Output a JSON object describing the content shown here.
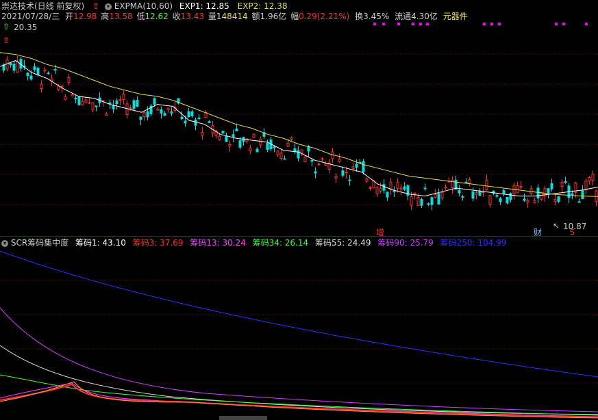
{
  "header": {
    "stock_title": "崇达技术(日线 前复权)",
    "indicator_name": "EXPMA(10,60)",
    "exp1_label": "EXP1: 12.85",
    "exp2_label": "EXP2: 12.38"
  },
  "quote": {
    "date": "2021/07/28/三",
    "open_label": "开",
    "open": "12.98",
    "high_label": "高",
    "high": "13.58",
    "low_label": "低",
    "low": "12.62",
    "close_label": "收",
    "close": "13.43",
    "volume_label": "量",
    "volume": "148414",
    "amount_label": "额",
    "amount": "1.96亿",
    "change_label": "幅",
    "change": "0.29(2.21%)",
    "turnover_label": "换",
    "turnover": "3.45%",
    "float_label": "流通",
    "float": "4.30亿",
    "sector": "元器件"
  },
  "price_chart": {
    "high_marker": "20.35",
    "low_marker": "10.87",
    "event_labels": [
      "增",
      "财",
      "S"
    ],
    "colors": {
      "up": "#ff3030",
      "down": "#00e0e0",
      "exp1": "#ffffff",
      "exp2": "#e8e04a",
      "grid": "#8b0000"
    }
  },
  "indicator": {
    "name": "SCR筹码集中度",
    "c1": "筹码1: 43.10",
    "c3": "筹码3: 37.69",
    "c13": "筹码13: 30.24",
    "c34": "筹码34: 26.14",
    "c55": "筹码55: 24.49",
    "c90": "筹码90: 25.79",
    "c250": "筹码250: 104.99",
    "colors": {
      "c1": "#ffffff",
      "c3": "#ff3030",
      "c13": "#ff40ff",
      "c34": "#40ff40",
      "c55": "#dddddd",
      "c90": "#cc40ff",
      "c250": "#3030ff"
    }
  },
  "chart_data": {
    "type": "line",
    "title": "崇达技术(日线 前复权)",
    "series": [
      {
        "name": "EXP1",
        "values": [
          18.9,
          19.2,
          18.6,
          18.3,
          17.8,
          17.4,
          17.3,
          17.0,
          16.8,
          16.6,
          17.0,
          16.9,
          16.2,
          16.0,
          15.5,
          15.3,
          15.2,
          15.1,
          14.7,
          14.6,
          14.2,
          14.0,
          13.8,
          13.6,
          13.0,
          12.7,
          12.5,
          12.4,
          12.6,
          12.8,
          12.7,
          12.6,
          12.5,
          12.4,
          12.4,
          12.5,
          12.6,
          12.7,
          12.85
        ]
      },
      {
        "name": "EXP2",
        "values": [
          19.6,
          19.5,
          19.3,
          19.0,
          18.8,
          18.5,
          18.2,
          17.9,
          17.7,
          17.5,
          17.4,
          17.2,
          16.9,
          16.6,
          16.3,
          16.0,
          15.8,
          15.5,
          15.3,
          15.0,
          14.8,
          14.5,
          14.3,
          14.0,
          13.8,
          13.6,
          13.4,
          13.3,
          13.2,
          13.1,
          13.0,
          12.9,
          12.8,
          12.7,
          12.6,
          12.5,
          12.45,
          12.4,
          12.38
        ]
      }
    ],
    "ylim": [
      10.5,
      21.0
    ]
  }
}
